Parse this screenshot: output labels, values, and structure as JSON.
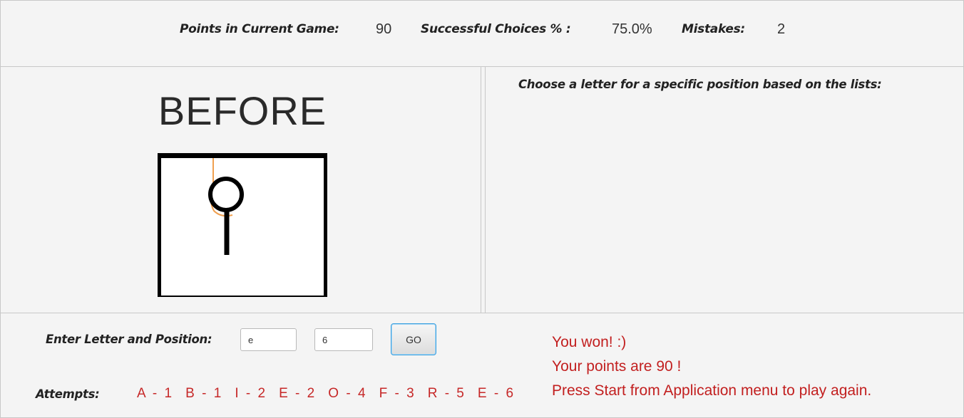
{
  "stats": {
    "points_label": "Points in Current Game:",
    "points_value": "90",
    "success_label": "Successful Choices % :",
    "success_value": "75.0%",
    "mistakes_label": "Mistakes:",
    "mistakes_value": "2"
  },
  "game": {
    "word": "BEFORE",
    "instructions": "Choose a letter for a specific position based on the lists:"
  },
  "input": {
    "enter_label": "Enter Letter and Position:",
    "letter_value": "e",
    "position_value": "6",
    "go_label": "GO"
  },
  "attempts": {
    "label": "Attempts:",
    "value": "A - 1  B - 1  I - 2  E - 2  O - 4  F - 3  R - 5  E - 6"
  },
  "messages": {
    "line1": "You won! :)",
    "line2": "Your points are 90 !",
    "line3": "Press Start from Application menu to play again."
  },
  "colors": {
    "message_red": "#c21f1f",
    "attempts_red": "#c62828",
    "rope_orange": "#f0a050",
    "focus_blue": "#3aa0e0"
  },
  "icons": {
    "hangman_drawing": "hangman-figure-icon"
  }
}
